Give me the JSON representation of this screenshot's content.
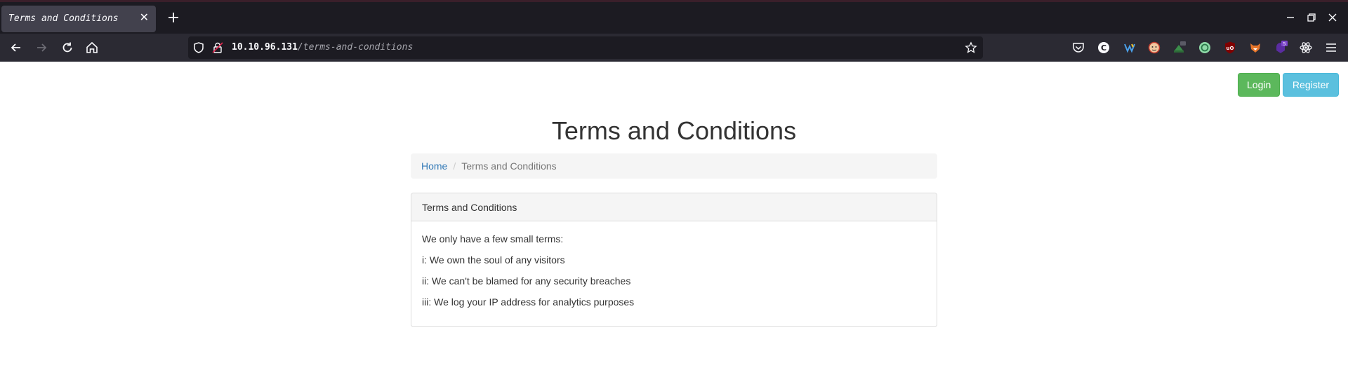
{
  "browser": {
    "tab_title": "Terms and Conditions",
    "url_host": "10.10.96.131",
    "url_path": "/terms-and-conditions"
  },
  "header": {
    "login_label": "Login",
    "register_label": "Register"
  },
  "main": {
    "title": "Terms and Conditions",
    "breadcrumb": {
      "home": "Home",
      "separator": "/",
      "current": "Terms and Conditions"
    },
    "panel": {
      "heading": "Terms and Conditions",
      "terms": [
        "We only have a few small terms:",
        "i: We own the soul of any visitors",
        "ii: We can't be blamed for any security breaches",
        "iii: We log your IP address for analytics purposes"
      ]
    }
  },
  "colors": {
    "login": "#5cb85c",
    "register": "#5bc0de",
    "link": "#337ab7"
  }
}
